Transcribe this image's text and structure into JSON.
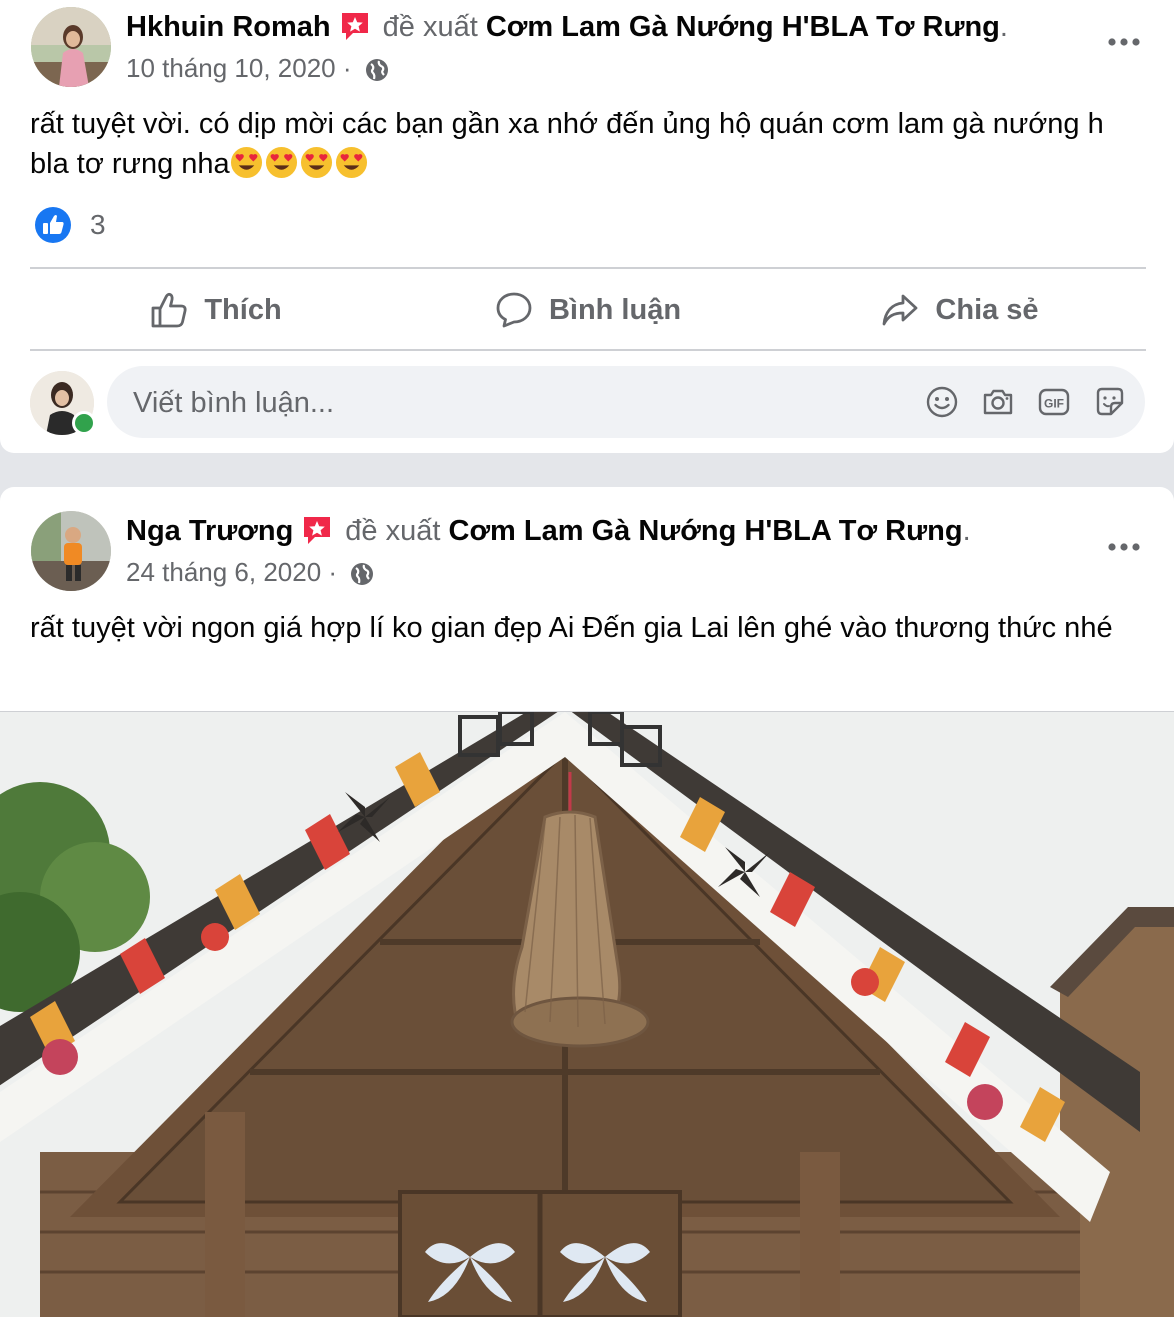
{
  "posts": [
    {
      "author": "Hkhuin Romah",
      "verb": "đề xuất",
      "page": "Cơm Lam Gà Nướng H'BLA Tơ Rưng",
      "date": "10 tháng 10, 2020",
      "privacy_icon": "globe-icon",
      "text": "rất tuyệt vời. có dịp mời các bạn gần xa nhớ đến ủng hộ quán cơm lam gà nướng h bla tơ rưng nha",
      "emojis": [
        "heart-eyes-emoji",
        "heart-eyes-emoji",
        "heart-eyes-emoji",
        "heart-eyes-emoji"
      ],
      "reaction_icon": "like-icon",
      "reaction_count": "3"
    },
    {
      "author": "Nga Trương",
      "verb": "đề xuất",
      "page": "Cơm Lam Gà Nướng H'BLA Tơ Rưng",
      "date": "24 tháng 6, 2020",
      "privacy_icon": "globe-icon",
      "text": "rất tuyệt vời ngon giá hợp lí ko gian đẹp Ai Đến gia Lai lên ghé vào thương thức nhé"
    }
  ],
  "actions": {
    "like": "Thích",
    "comment": "Bình luận",
    "share": "Chia sẻ"
  },
  "comment_box": {
    "placeholder": "Viết bình luận...",
    "icons": [
      "emoji-icon",
      "camera-icon",
      "gif-icon",
      "sticker-icon"
    ]
  },
  "colors": {
    "like_blue": "#1877f2",
    "recommend_red": "#f02849",
    "online_green": "#31a24c"
  }
}
